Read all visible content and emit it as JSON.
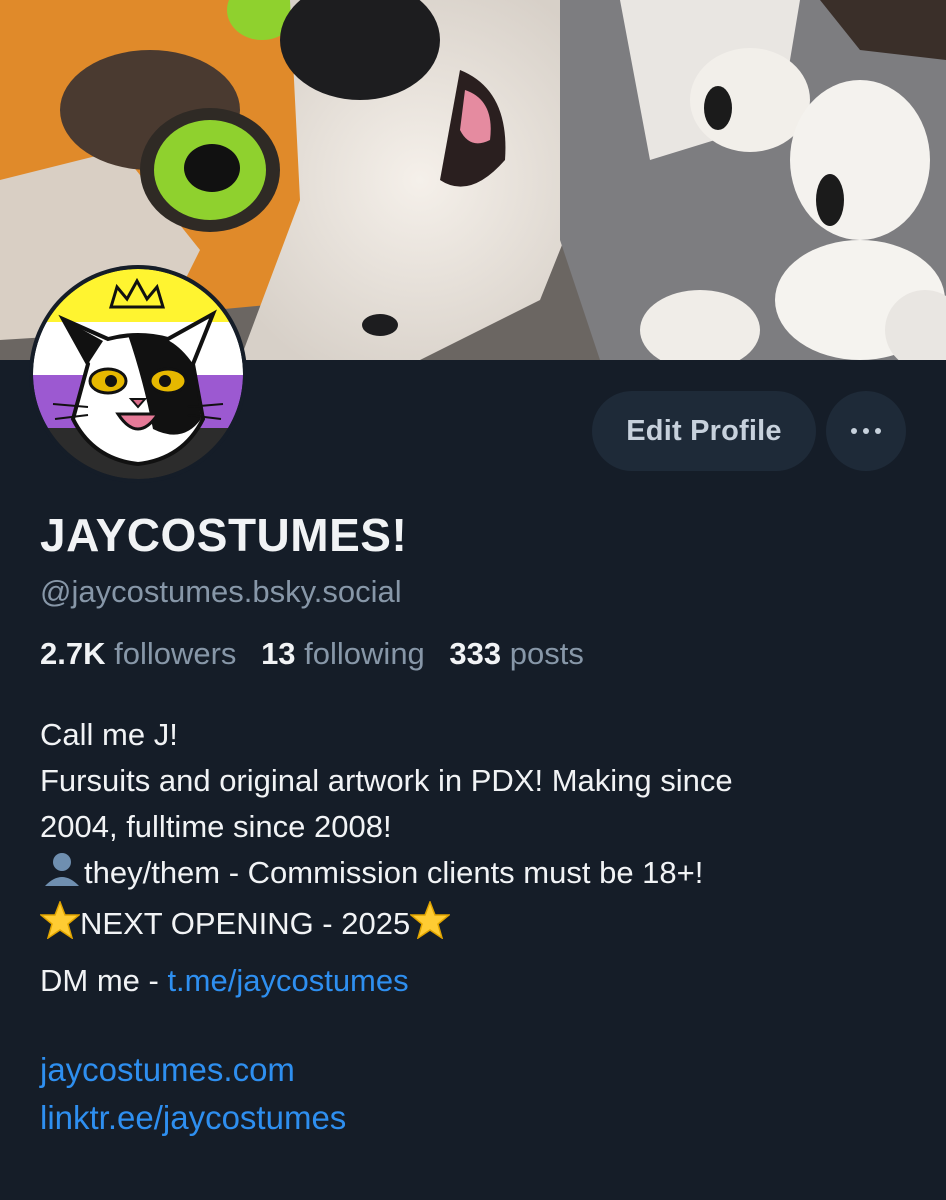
{
  "profile": {
    "display_name": "JAYCOSTUMES!",
    "handle": "@jaycostumes.bsky.social",
    "edit_label": "Edit Profile",
    "stats": {
      "followers_count": "2.7K",
      "followers_label": "followers",
      "following_count": "13",
      "following_label": "following",
      "posts_count": "333",
      "posts_label": "posts"
    },
    "bio": {
      "line1": "Call me J!",
      "line2": "Fursuits and original artwork in PDX! Making since",
      "line3": "2004, fulltime since 2008!",
      "line4": "they/them - Commission clients must be 18+!",
      "line5": "NEXT OPENING - 2025",
      "dm_prefix": "DM me - ",
      "dm_link": "t.me/jaycostumes"
    },
    "links": [
      "jaycostumes.com",
      "linktr.ee/jaycostumes"
    ]
  },
  "icons": {
    "more": "more-options-icon",
    "star": "star-emoji-icon",
    "person": "person-silhouette-icon"
  },
  "colors": {
    "background": "#151d28",
    "button_bg": "#1e2a38",
    "link": "#2e8ff0",
    "muted_text": "#8797a8",
    "primary_text": "#f1f3f5",
    "avatar_flag_yellow": "#fff430",
    "avatar_flag_purple": "#9c59d1",
    "avatar_flag_black": "#2c2c2c"
  }
}
